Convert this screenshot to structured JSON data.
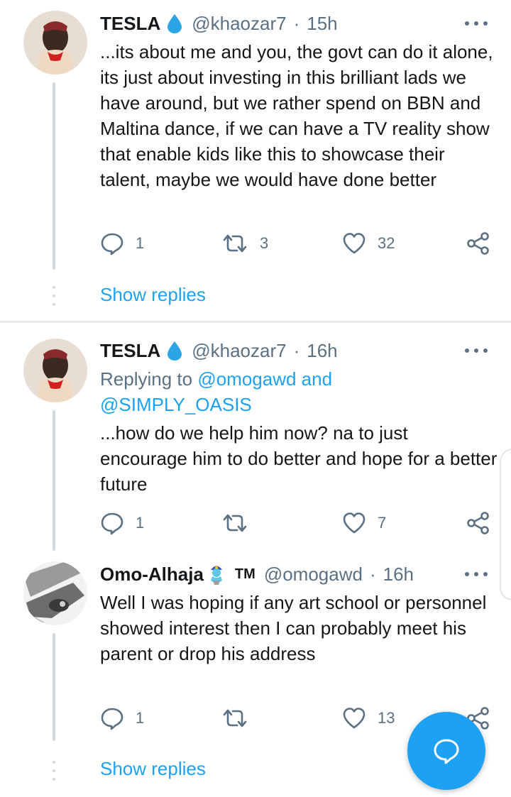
{
  "colors": {
    "accent": "#1da1f2",
    "muted": "#5b7083",
    "separator": "#e6ecf0"
  },
  "tweets": [
    {
      "name": "TESLA",
      "badge_icon": "droplet-icon",
      "handle": "@khaozar7",
      "sep": "·",
      "time": "15h",
      "text": "...its about me and you, the govt can do it alone, its just about investing in this brilliant lads we have around, but we rather spend on BBN and Maltina dance, if we can have a TV reality show that enable kids like this to showcase their talent, maybe we would have done better",
      "replies": "1",
      "retweets": "3",
      "likes": "32"
    },
    {
      "name": "TESLA",
      "badge_icon": "droplet-icon",
      "handle": "@khaozar7",
      "sep": "·",
      "time": "16h",
      "replying_prefix": "Replying to ",
      "replying_1": "@omogawd",
      "replying_and": " and",
      "replying_2": "@SIMPLY_OASIS",
      "text": "...how do we help him now? na to just encourage him to do better and hope for a better future",
      "replies": "1",
      "retweets": "",
      "likes": "7"
    },
    {
      "name": "Omo-Alhaja",
      "badge_icon": "genie-emoji-icon",
      "tm": "TM",
      "handle": "@omogawd",
      "sep": "·",
      "time": "16h",
      "text": "Well I was hoping if any art school or personnel showed interest then I can probably meet his parent or drop his address",
      "replies": "1",
      "retweets": "",
      "likes": "13"
    }
  ],
  "show_replies_label": "Show replies",
  "compose_icon": "compose-reply-icon"
}
